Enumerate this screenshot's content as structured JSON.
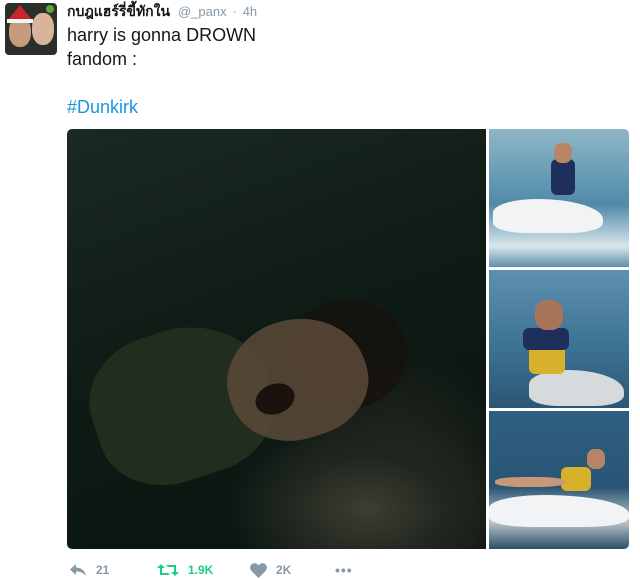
{
  "header": {
    "display_name": "กบฎแฮร์รี่ขี้ทักใน",
    "handle": "@_panx",
    "separator": "·",
    "time": "4h"
  },
  "tweet": {
    "lines": [
      "harry is gonna DROWN",
      "fandom :"
    ],
    "hashtag": "#Dunkirk"
  },
  "media": {
    "count": 4
  },
  "actions": {
    "replies": "21",
    "retweets": "1.9K",
    "likes": "2K",
    "more": "•••"
  },
  "colors": {
    "text": "#14171a",
    "muted": "#8899a6",
    "link": "#1b95e0",
    "retweet_active": "#19cf86"
  },
  "icons": [
    "reply-icon",
    "retweet-icon",
    "heart-icon",
    "more-icon"
  ]
}
